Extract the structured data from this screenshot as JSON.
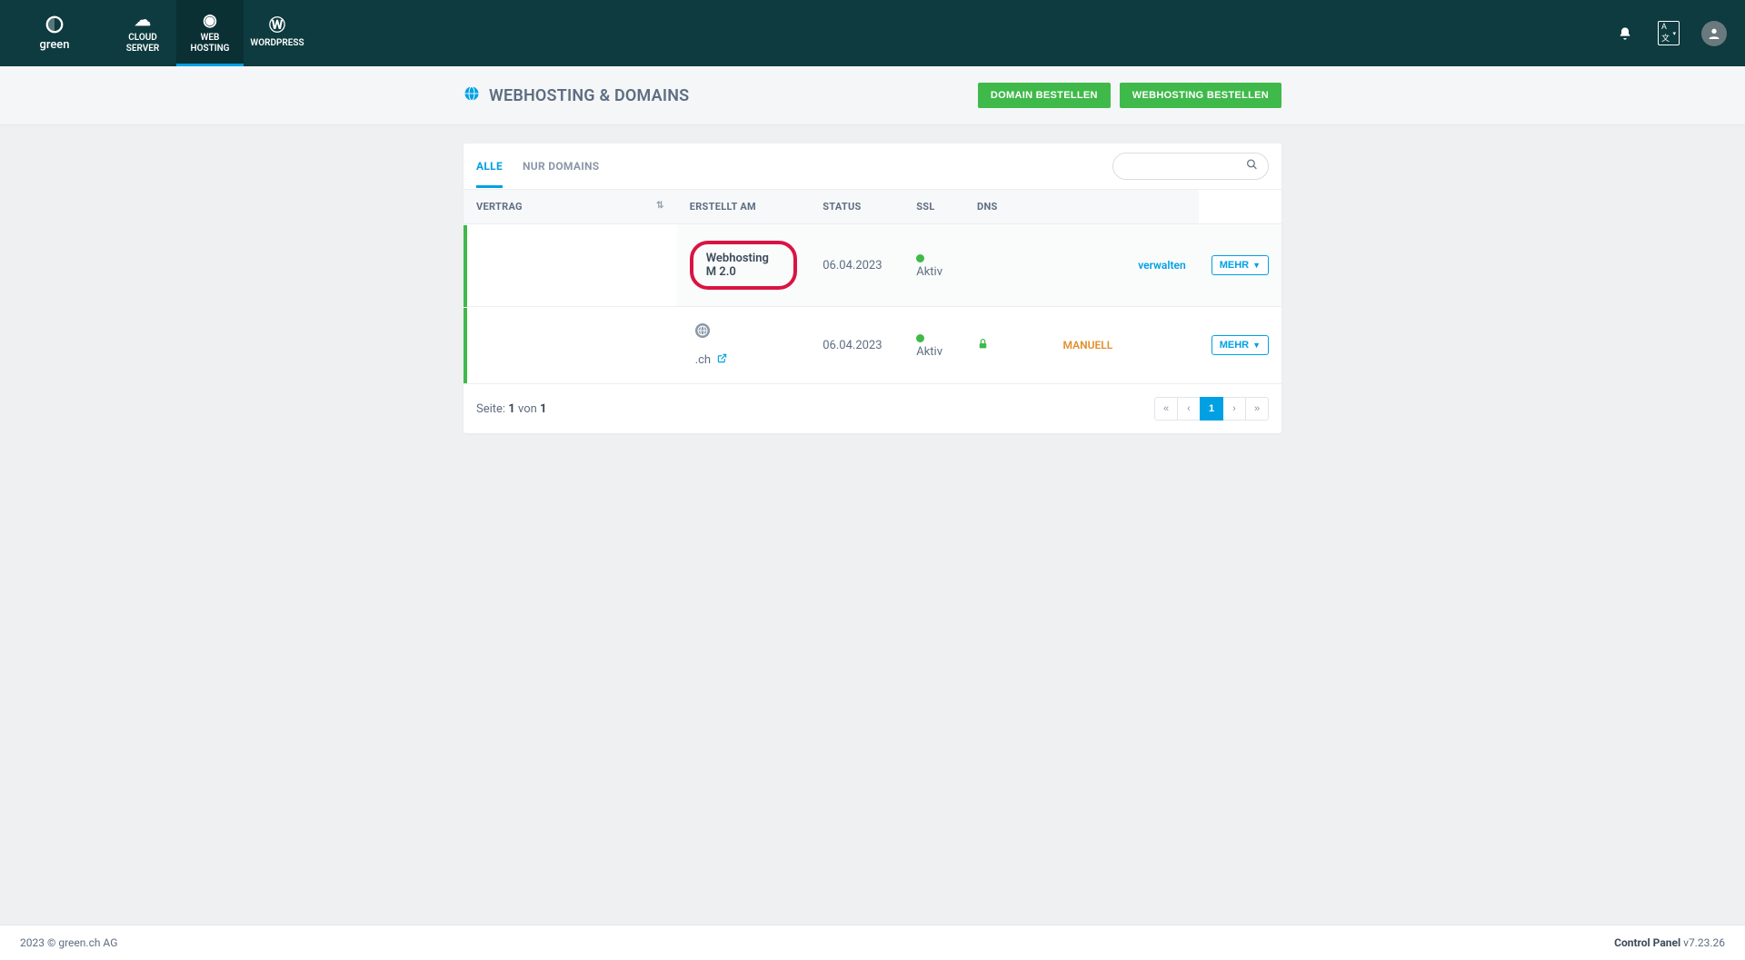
{
  "brand": {
    "label": "green"
  },
  "nav": {
    "items": [
      {
        "label": "CLOUD\nSERVER",
        "icon": "☁"
      },
      {
        "label": "WEB\nHOSTING",
        "icon": "◉",
        "active": true
      },
      {
        "label": "WORDPRESS",
        "icon": "Ⓦ"
      }
    ],
    "right": {
      "lang": "A文"
    }
  },
  "subheader": {
    "title": "WEBHOSTING & DOMAINS",
    "btn_domain": "DOMAIN BESTELLEN",
    "btn_hosting": "WEBHOSTING BESTELLEN"
  },
  "tabs": {
    "all": "ALLE",
    "domains_only": "NUR DOMAINS"
  },
  "table": {
    "headers": {
      "contract": "VERTRAG",
      "created": "ERSTELLT AM",
      "status": "STATUS",
      "ssl": "SSL",
      "dns": "DNS"
    },
    "rows": {
      "hosting": {
        "name": "Webhosting M 2.0",
        "created": "06.04.2023",
        "status": "Aktiv",
        "manage": "verwalten",
        "more": "MEHR"
      },
      "domain": {
        "name": ".ch",
        "created": "06.04.2023",
        "status": "Aktiv",
        "dns": "MANUELL",
        "more": "MEHR"
      }
    }
  },
  "pagination": {
    "info_prefix": "Seite: ",
    "current": "1",
    "mid": " von ",
    "total": "1"
  },
  "footer": {
    "left": "2023 © green.ch AG",
    "right_label": "Control Panel ",
    "right_version": "v7.23.26"
  }
}
